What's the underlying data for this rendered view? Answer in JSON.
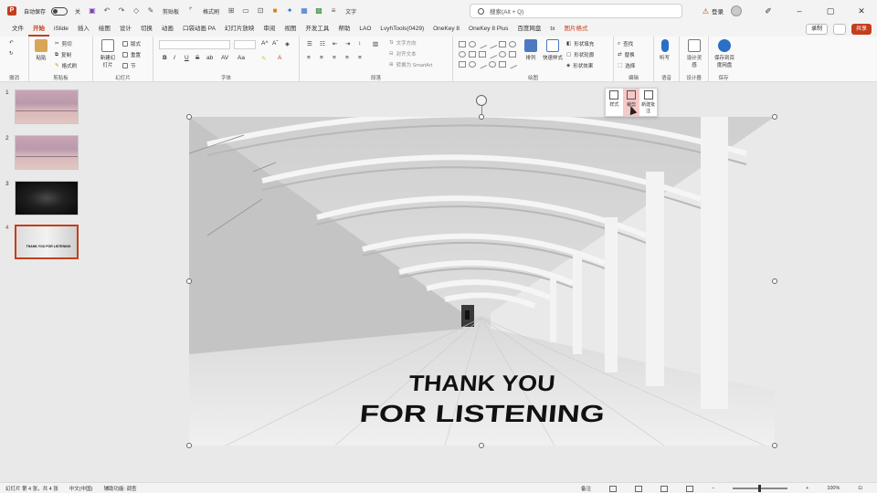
{
  "titlebar": {
    "autosave_label": "自动保存",
    "toggle_state": "关",
    "qa_text_1": "剪贴板",
    "qa_text_2": "格式刷",
    "qa_text_3": "文字",
    "search_placeholder": "搜索(Alt + Q)",
    "login_label": "登录",
    "min": "–",
    "max": "▢",
    "close": "✕"
  },
  "tabs": [
    {
      "label": "文件"
    },
    {
      "label": "开始"
    },
    {
      "label": "iSlide"
    },
    {
      "label": "插入"
    },
    {
      "label": "绘图"
    },
    {
      "label": "设计"
    },
    {
      "label": "切换"
    },
    {
      "label": "动画"
    },
    {
      "label": "口袋动画 PA"
    },
    {
      "label": "幻灯片放映"
    },
    {
      "label": "审阅"
    },
    {
      "label": "视图"
    },
    {
      "label": "开发工具"
    },
    {
      "label": "帮助"
    },
    {
      "label": "LAO"
    },
    {
      "label": "LvyhTools(0429)"
    },
    {
      "label": "OneKey 8"
    },
    {
      "label": "OneKey 8 Plus"
    },
    {
      "label": "百度网盘"
    },
    {
      "label": "tx"
    },
    {
      "label": "图片格式"
    }
  ],
  "tabs_right": {
    "record": "录制",
    "share": "共享"
  },
  "ribbon": {
    "groups": {
      "undo": "撤消",
      "clipboard": "剪贴板",
      "slides": "幻灯片",
      "font": "字体",
      "paragraph": "段落",
      "drawing": "绘图",
      "editing": "编辑",
      "voice": "语音",
      "designer": "设计器",
      "save": "保存"
    },
    "paste": "粘贴",
    "cut": "剪切",
    "copy": "复制",
    "format_painter": "格式刷",
    "new_slide": "新建幻灯片",
    "layout": "版式",
    "reset": "重置",
    "section": "节",
    "font_grow": "A^",
    "font_shrink": "Aˇ",
    "bold": "B",
    "italic": "I",
    "underline": "U",
    "strike": "S",
    "text_direction": "文字方向",
    "align_text": "对齐文本",
    "smartart": "转换为 SmartArt",
    "arrange": "排列",
    "quick_styles": "快速样式",
    "shape_fill": "形状填充",
    "shape_outline": "形状轮廓",
    "shape_effects": "形状效果",
    "find": "查找",
    "replace": "替换",
    "select": "选择",
    "dictate": "听写",
    "design_ideas": "设计灵感",
    "save_to": "保存到百度网盘"
  },
  "slides_panel": [
    {
      "num": "1",
      "type": "sunset",
      "text": ""
    },
    {
      "num": "2",
      "type": "sunset",
      "text": ""
    },
    {
      "num": "3",
      "type": "dark",
      "text": ""
    },
    {
      "num": "4",
      "type": "arch",
      "text": "THANK YOU FOR LISTENING"
    }
  ],
  "slide": {
    "line1": "THANK YOU",
    "line2": "FOR LISTENING"
  },
  "float_toolbar": {
    "style": "样式",
    "crop": "裁剪",
    "new_comment": "新建批注"
  },
  "statusbar": {
    "slide_info": "幻灯片 第 4 张，共 4 张",
    "language": "中文(中国)",
    "accessibility": "辅助功能: 调查",
    "notes": "备注",
    "zoom": "100%"
  },
  "colors": {
    "accent": "#c43e1c"
  }
}
